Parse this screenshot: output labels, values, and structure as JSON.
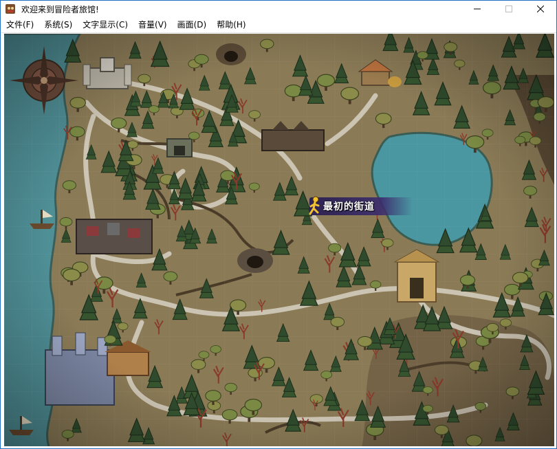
{
  "window": {
    "title": "欢迎来到冒险者旅馆!"
  },
  "menu": [
    {
      "label": "文件(F)"
    },
    {
      "label": "系统(S)"
    },
    {
      "label": "文字显示(C)"
    },
    {
      "label": "音量(V)"
    },
    {
      "label": "画面(D)"
    },
    {
      "label": "帮助(H)"
    }
  ],
  "map": {
    "location_label": "最初的街道",
    "colors": {
      "parchment": "#8a7a56",
      "sea": "#4f8f96",
      "lake": "#4a97a2",
      "road": "#d8d2c4",
      "tree_dark": "#2f4a2c",
      "label_bg": "#2d2366",
      "label_runner": "#f2c12e"
    }
  }
}
